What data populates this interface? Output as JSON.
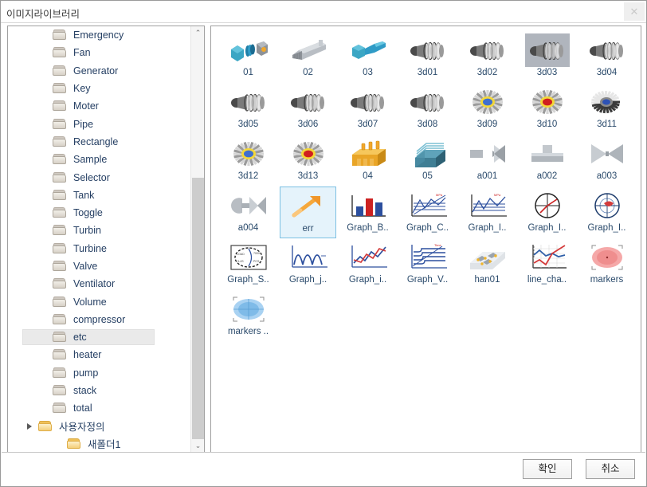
{
  "window": {
    "title": "이미지라이브러리",
    "close_icon": "close-icon",
    "close_label": "✕"
  },
  "tree": {
    "scroll_up_icon": "chevron-up-icon",
    "scroll_down_icon": "chevron-down-icon",
    "scroll_up_label": "⌃",
    "scroll_down_label": "⌄",
    "items": [
      {
        "label": "Emergency",
        "level": 1,
        "icon": "folder-icon",
        "selected": false,
        "expandable": false
      },
      {
        "label": "Fan",
        "level": 1,
        "icon": "folder-icon",
        "selected": false,
        "expandable": false
      },
      {
        "label": "Generator",
        "level": 1,
        "icon": "folder-icon",
        "selected": false,
        "expandable": false
      },
      {
        "label": "Key",
        "level": 1,
        "icon": "folder-icon",
        "selected": false,
        "expandable": false
      },
      {
        "label": "Moter",
        "level": 1,
        "icon": "folder-icon",
        "selected": false,
        "expandable": false
      },
      {
        "label": "Pipe",
        "level": 1,
        "icon": "folder-icon",
        "selected": false,
        "expandable": false
      },
      {
        "label": "Rectangle",
        "level": 1,
        "icon": "folder-icon",
        "selected": false,
        "expandable": false
      },
      {
        "label": "Sample",
        "level": 1,
        "icon": "folder-icon",
        "selected": false,
        "expandable": false
      },
      {
        "label": "Selector",
        "level": 1,
        "icon": "folder-icon",
        "selected": false,
        "expandable": false
      },
      {
        "label": "Tank",
        "level": 1,
        "icon": "folder-icon",
        "selected": false,
        "expandable": false
      },
      {
        "label": "Toggle",
        "level": 1,
        "icon": "folder-icon",
        "selected": false,
        "expandable": false
      },
      {
        "label": "Turbin",
        "level": 1,
        "icon": "folder-icon",
        "selected": false,
        "expandable": false
      },
      {
        "label": "Turbine",
        "level": 1,
        "icon": "folder-icon",
        "selected": false,
        "expandable": false
      },
      {
        "label": "Valve",
        "level": 1,
        "icon": "folder-icon",
        "selected": false,
        "expandable": false
      },
      {
        "label": "Ventilator",
        "level": 1,
        "icon": "folder-icon",
        "selected": false,
        "expandable": false
      },
      {
        "label": "Volume",
        "level": 1,
        "icon": "folder-icon",
        "selected": false,
        "expandable": false
      },
      {
        "label": "compressor",
        "level": 1,
        "icon": "folder-icon",
        "selected": false,
        "expandable": false
      },
      {
        "label": "etc",
        "level": 1,
        "icon": "folder-icon",
        "selected": true,
        "expandable": false
      },
      {
        "label": "heater",
        "level": 1,
        "icon": "folder-icon",
        "selected": false,
        "expandable": false
      },
      {
        "label": "pump",
        "level": 1,
        "icon": "folder-icon",
        "selected": false,
        "expandable": false
      },
      {
        "label": "stack",
        "level": 1,
        "icon": "folder-icon",
        "selected": false,
        "expandable": false
      },
      {
        "label": "total",
        "level": 1,
        "icon": "folder-icon",
        "selected": false,
        "expandable": false
      },
      {
        "label": "사용자정의",
        "level": 0,
        "icon": "folder-open-icon",
        "selected": false,
        "expandable": true
      },
      {
        "label": "새폴더1",
        "level": 2,
        "icon": "folder-open-icon",
        "selected": false,
        "expandable": false
      }
    ]
  },
  "grid": {
    "items": [
      {
        "label": "01",
        "art": "machine-blue-cube",
        "selected": "none"
      },
      {
        "label": "02",
        "art": "machine-gray-rail",
        "selected": "none"
      },
      {
        "label": "03",
        "art": "machine-blue-cone",
        "selected": "none"
      },
      {
        "label": "3d01",
        "art": "turbine-3d",
        "selected": "none"
      },
      {
        "label": "3d02",
        "art": "turbine-3d",
        "selected": "none"
      },
      {
        "label": "3d03",
        "art": "turbine-3d",
        "selected": "gray"
      },
      {
        "label": "3d04",
        "art": "turbine-3d",
        "selected": "none"
      },
      {
        "label": "3d05",
        "art": "turbine-3d",
        "selected": "none"
      },
      {
        "label": "3d06",
        "art": "turbine-3d",
        "selected": "none"
      },
      {
        "label": "3d07",
        "art": "turbine-3d",
        "selected": "none"
      },
      {
        "label": "3d08",
        "art": "turbine-3d",
        "selected": "none"
      },
      {
        "label": "3d09",
        "art": "fan-blue-hub",
        "selected": "none"
      },
      {
        "label": "3d10",
        "art": "fan-red-hub",
        "selected": "none"
      },
      {
        "label": "3d11",
        "art": "fan-angled",
        "selected": "none"
      },
      {
        "label": "3d12",
        "art": "fan-blue-hub",
        "selected": "none"
      },
      {
        "label": "3d13",
        "art": "fan-red-hub",
        "selected": "none"
      },
      {
        "label": "04",
        "art": "tank-yellow",
        "selected": "none"
      },
      {
        "label": "05",
        "art": "heatsink-blue",
        "selected": "none"
      },
      {
        "label": "a001",
        "art": "valve-gray-1",
        "selected": "none"
      },
      {
        "label": "a002",
        "art": "valve-gray-2",
        "selected": "none"
      },
      {
        "label": "a003",
        "art": "valve-bowtie",
        "selected": "none"
      },
      {
        "label": "a004",
        "art": "valve-gray-3",
        "selected": "none"
      },
      {
        "label": "err",
        "art": "orange-arrow",
        "selected": "blue"
      },
      {
        "label": "Graph_B..",
        "art": "bar-chart",
        "selected": "none"
      },
      {
        "label": "Graph_C..",
        "art": "scatter-trend-chart",
        "selected": "none"
      },
      {
        "label": "Graph_I..",
        "art": "line-trend-chart",
        "selected": "none"
      },
      {
        "label": "Graph_I..",
        "art": "polar-chart",
        "selected": "none"
      },
      {
        "label": "Graph_I..",
        "art": "polar-red-chart",
        "selected": "none"
      },
      {
        "label": "Graph_S..",
        "art": "gauge-dashed-chart",
        "selected": "none"
      },
      {
        "label": "Graph_j..",
        "art": "sine-wave-chart",
        "selected": "none"
      },
      {
        "label": "Graph_i..",
        "art": "crossing-lines-chart",
        "selected": "none"
      },
      {
        "label": "Graph_V..",
        "art": "timeline-chart",
        "selected": "none"
      },
      {
        "label": "han01",
        "art": "conveyor-3d",
        "selected": "none"
      },
      {
        "label": "line_cha..",
        "art": "line-chart-grid",
        "selected": "none"
      },
      {
        "label": "markers",
        "art": "marker-red-ellipse",
        "selected": "none"
      },
      {
        "label": "markers ..",
        "art": "marker-blue-ellipse",
        "selected": "none"
      }
    ]
  },
  "footer": {
    "ok_label": "확인",
    "cancel_label": "취소"
  },
  "colors": {
    "selection_blue_bg": "#e5f3fb",
    "selection_blue_border": "#7cc0e3",
    "selection_gray": "#b0b5bd",
    "label_text": "#2a4a6b",
    "panel_border": "#a0a0a0"
  }
}
